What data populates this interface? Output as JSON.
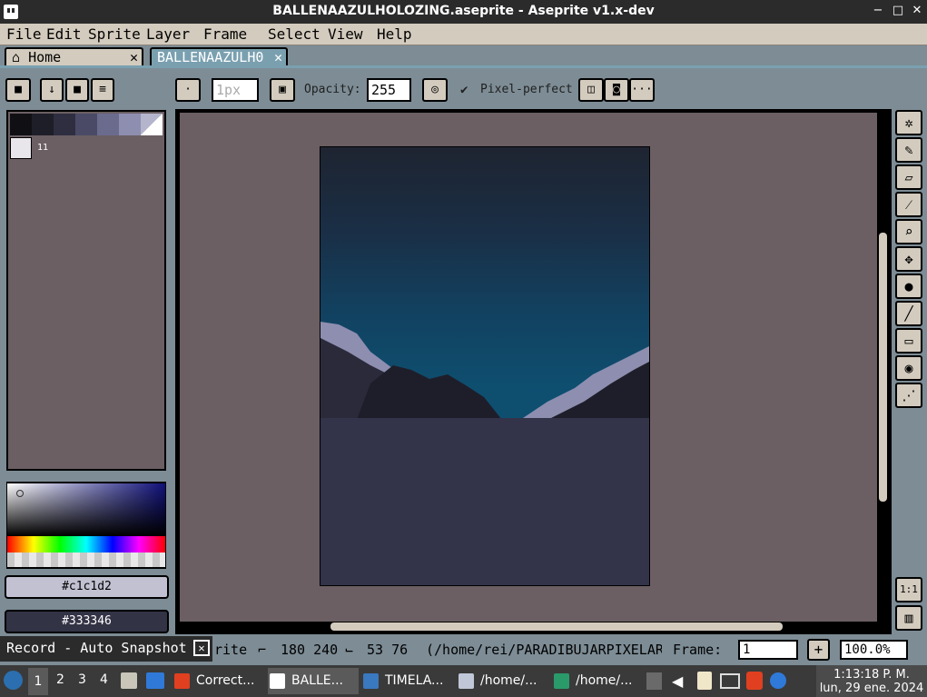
{
  "window": {
    "title": "BALLENAAZULHOLOZING.aseprite - Aseprite v1.x-dev",
    "minimize": "−",
    "restore": "□",
    "close": "✕"
  },
  "menu": [
    "File",
    "Edit",
    "Sprite",
    "Layer",
    "Frame",
    "Select",
    "View",
    "Help"
  ],
  "tabs": {
    "home": {
      "label": "Home",
      "close": "✕"
    },
    "file": {
      "label": "BALLENAAZULH0",
      "close": "✕"
    }
  },
  "toolbar": {
    "brush_size": "1px",
    "opacity_label": "Opacity:",
    "opacity_value": "255",
    "pixel_perfect_label": "Pixel-perfect",
    "more": "···"
  },
  "palette": {
    "colors": [
      "#101014",
      "#1e1e28",
      "#2e2e40",
      "#4a4a66",
      "#6b6b8e",
      "#8e8eb0",
      "#b4b4cc",
      "#ffffff"
    ],
    "last": "#e8e6ea",
    "index_label": "11"
  },
  "colors": {
    "foreground_hex": "#c1c1d2",
    "background_hex": "#333346",
    "foreground": "#c1c1d2",
    "background": "#333346"
  },
  "status": {
    "record_label": "Record - Auto Snapshot",
    "record_close": "✕",
    "file_prefix": "rite",
    "size": "180 240",
    "position": "53 76",
    "path": "(/home/rei/PARADIBUJARPIXELAR",
    "frame_label": "Frame:",
    "frame_value": "1",
    "zoom": "100.0%"
  },
  "taskbar": {
    "workspaces": [
      "1",
      "2",
      "3",
      "4"
    ],
    "apps": [
      {
        "label": "Correct...",
        "color": "#e04020"
      },
      {
        "label": "BALLE...",
        "color": "#ffffff"
      },
      {
        "label": "TIMELA...",
        "color": "#3a78c0"
      },
      {
        "label": "/home/...",
        "color": "#c0c8d8"
      },
      {
        "label": "/home/...",
        "color": "#2a9a6a"
      }
    ],
    "time": "1:13:18 P. M.",
    "date": "lun, 29 ene. 2024"
  }
}
